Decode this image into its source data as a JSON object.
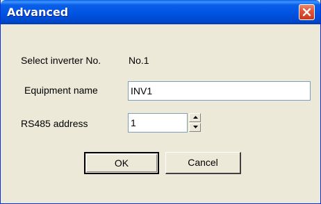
{
  "window": {
    "title": "Advanced",
    "close_icon": "close-icon",
    "close_color": "#E2553A"
  },
  "fields": {
    "inverter_label": "Select inverter No.",
    "inverter_value": "No.1",
    "equipment_label": "Equipment name",
    "equipment_value": "INV1",
    "rs485_label": "RS485 address",
    "rs485_value": "1"
  },
  "spin": {
    "up_icon": "arrow-up-icon",
    "down_icon": "arrow-down-icon"
  },
  "buttons": {
    "ok": "OK",
    "cancel": "Cancel"
  }
}
